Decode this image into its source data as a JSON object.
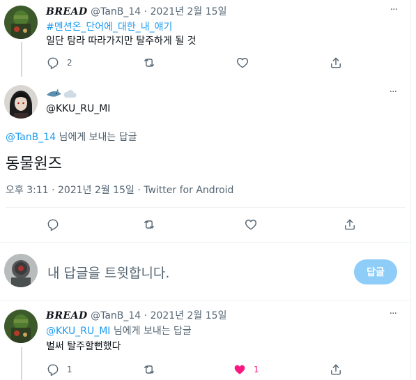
{
  "tweet1": {
    "name": "𝑩𝑹𝑬𝑨𝑫",
    "meta": "@TanB_14 · 2021년 2월 15일",
    "hashtag": "#멘션온_단어에_대한_내_얘기",
    "text": "일단 탐라 따라가지만 탈주하게 될 것",
    "reply_count": "2",
    "retweet_count": "",
    "like_count": "",
    "more_label": "···"
  },
  "main": {
    "handle": "@KKU_RU_MI",
    "emoji": [
      "shark-emoji",
      "cloud-emoji"
    ],
    "reply_to_handle": "@TanB_14",
    "reply_to_suffix": " 님에게 보내는 답글",
    "text": "동물원즈",
    "timestamp": "오후 3:11 · 2021년 2월 15일 · Twitter for Android",
    "more_label": "···"
  },
  "composer": {
    "placeholder": "내 답글을 트윗합니다.",
    "button_label": "답글"
  },
  "tweet2": {
    "name": "𝑩𝑹𝑬𝑨𝑫",
    "meta": "@TanB_14 · 2021년 2월 15일",
    "reply_to_handle": "@KKU_RU_MI",
    "reply_to_suffix": " 님에게 보내는 답글",
    "text": "벌써 탈주할뻔했다",
    "reply_count": "1",
    "like_count": "1",
    "more_label": "···"
  },
  "colors": {
    "accent": "#1d9bf0",
    "like": "#f91880",
    "muted": "#536471",
    "button_disabled": "#8ecdf8"
  }
}
